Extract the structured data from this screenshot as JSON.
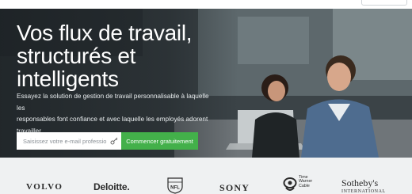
{
  "hero": {
    "headline_line1": "Vos flux de travail,",
    "headline_line2": "structurés et",
    "headline_line3": "intelligents",
    "subtitle_line1": "Essayez la solution de gestion de travail personnalisable à laquelle les",
    "subtitle_line2": "responsables font confiance et avec laquelle les employés adorent",
    "subtitle_line3": "travailler."
  },
  "signup": {
    "email_placeholder": "Saisissez votre e-mail professionnel",
    "cta_label": "Commencer gratuitement",
    "cta_color": "#43b04a"
  },
  "logos": {
    "volvo": "VOLVO",
    "deloitte": "Deloitte.",
    "nfl": "NFL",
    "sony": "SONY",
    "twc_line1": "Time",
    "twc_line2": "Warner",
    "twc_line3": "Cable",
    "sothebys": "Sotheby's",
    "sothebys_sub": "INTERNATIONAL"
  }
}
